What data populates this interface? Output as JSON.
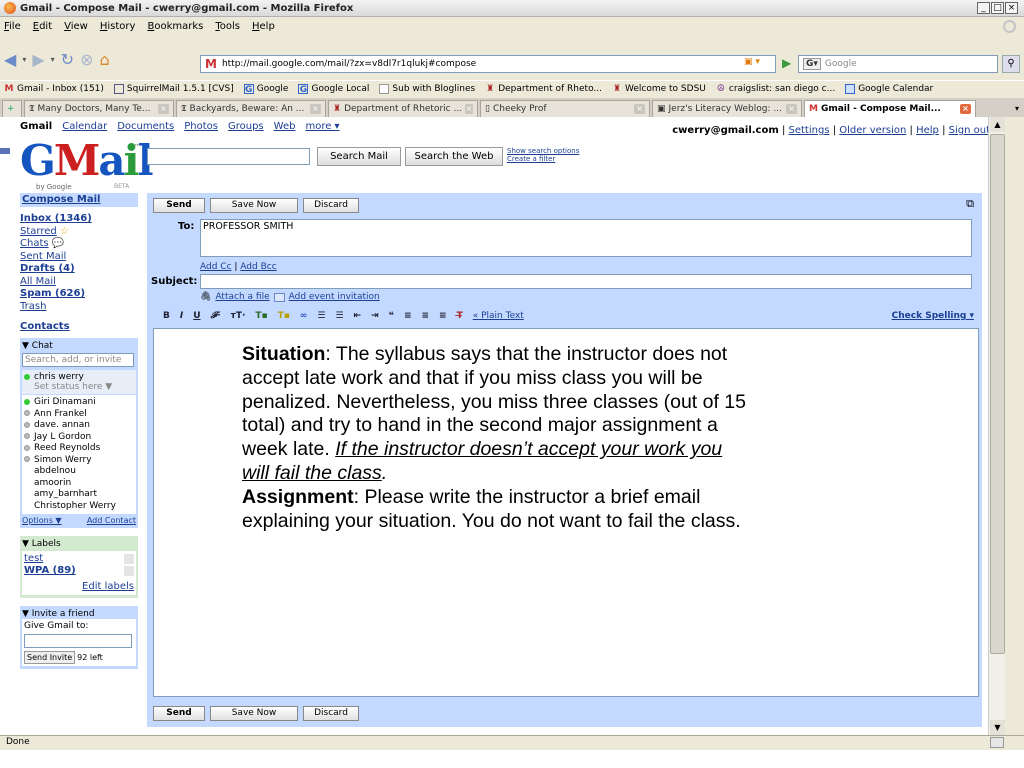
{
  "window": {
    "title": "Gmail - Compose Mail - cwerry@gmail.com - Mozilla Firefox"
  },
  "menu": [
    "File",
    "Edit",
    "View",
    "History",
    "Bookmarks",
    "Tools",
    "Help"
  ],
  "address": {
    "url": "http://mail.google.com/mail/?zx=v8dl7r1qlukj#compose",
    "search_placeholder": "Google"
  },
  "bookmarks": [
    {
      "label": "Gmail - Inbox (151)",
      "icon": "gmail-icon"
    },
    {
      "label": "SquirrelMail 1.5.1 [CVS]",
      "icon": "mail-icon"
    },
    {
      "label": "Google",
      "icon": "google-icon"
    },
    {
      "label": "Google Local",
      "icon": "google-icon"
    },
    {
      "label": "Sub with Bloglines",
      "icon": "page-icon"
    },
    {
      "label": "Department of Rheto...",
      "icon": "sdsu-icon"
    },
    {
      "label": "Welcome to SDSU",
      "icon": "sdsu-icon"
    },
    {
      "label": "craigslist: san diego c...",
      "icon": "peace-icon"
    },
    {
      "label": "Google Calendar",
      "icon": "calendar-icon"
    }
  ],
  "tabs": [
    {
      "label": "Many Doctors, Many Te...",
      "active": false
    },
    {
      "label": "Backyards, Beware: An ...",
      "active": false
    },
    {
      "label": "Department of Rhetoric ...",
      "active": false
    },
    {
      "label": "Cheeky Prof",
      "active": false
    },
    {
      "label": "Jerz's Literacy Weblog: ...",
      "active": false
    },
    {
      "label": "Gmail - Compose Mail...",
      "active": true
    }
  ],
  "gmail": {
    "topnav": [
      "Gmail",
      "Calendar",
      "Documents",
      "Photos",
      "Groups",
      "Web",
      "more ▾"
    ],
    "email": "cwerry@gmail.com",
    "toplinks": [
      "Settings",
      "Older version",
      "Help",
      "Sign out"
    ],
    "logo_by": "by Google",
    "logo_beta": "BETA",
    "search_mail": "Search Mail",
    "search_web": "Search the Web",
    "show_search_options": "Show search options",
    "create_filter": "Create a filter"
  },
  "sidebar": {
    "compose": "Compose Mail",
    "items": [
      "Inbox (1346)",
      "Starred",
      "Chats",
      "Sent Mail",
      "Drafts (4)",
      "All Mail",
      "Spam (626)",
      "Trash"
    ],
    "contacts": "Contacts",
    "chat_header": "▼ Chat",
    "chat_search_placeholder": "Search, add, or invite",
    "me_name": "chris werry",
    "me_status": "Set status here ▼",
    "contacts_list": [
      {
        "name": "Giri Dinamani",
        "status": "online"
      },
      {
        "name": "Ann Frankel",
        "status": "idle"
      },
      {
        "name": "dave. annan",
        "status": "idle"
      },
      {
        "name": "Jay L Gordon",
        "status": "idle"
      },
      {
        "name": "Reed Reynolds",
        "status": "idle"
      },
      {
        "name": "Simon Werry",
        "status": "idle"
      },
      {
        "name": "abdelnou",
        "status": "none"
      },
      {
        "name": "amoorin",
        "status": "none"
      },
      {
        "name": "amy_barnhart",
        "status": "none"
      },
      {
        "name": "Christopher Werry",
        "status": "none"
      }
    ],
    "options": "Options ▼",
    "add_contact": "Add Contact",
    "labels_header": "▼ Labels",
    "labels": [
      "test",
      "WPA (89)"
    ],
    "edit_labels": "Edit labels",
    "invite_header": "▼ Invite a friend",
    "invite_text": "Give Gmail to:",
    "send_invite": "Send Invite",
    "invites_left": "92 left"
  },
  "compose": {
    "send": "Send",
    "save_now": "Save Now",
    "discard": "Discard",
    "to_label": "To:",
    "to_value": "PROFESSOR SMITH",
    "add_cc": "Add Cc",
    "add_bcc": "Add Bcc",
    "subject_label": "Subject:",
    "attach_file": "Attach a file",
    "add_event": "Add event invitation",
    "plain_text": "« Plain Text",
    "check_spelling": "Check Spelling ▾"
  },
  "message": {
    "situation_label": "Situation",
    "situation_text": ": The syllabus says that the instructor does not accept late work and that if you miss class you will be penalized. Nevertheless, you miss three classes (out of 15 total) and try to hand in the second major assignment a week late. ",
    "situation_underline": "If the instructor doesn’t accept your work you will fail the class",
    "situation_end": ".",
    "assignment_label": "Assignment",
    "assignment_text": ": Please write the instructor a brief email explaining your situation. You do not want to fail the class."
  },
  "status": {
    "text": "Done"
  }
}
